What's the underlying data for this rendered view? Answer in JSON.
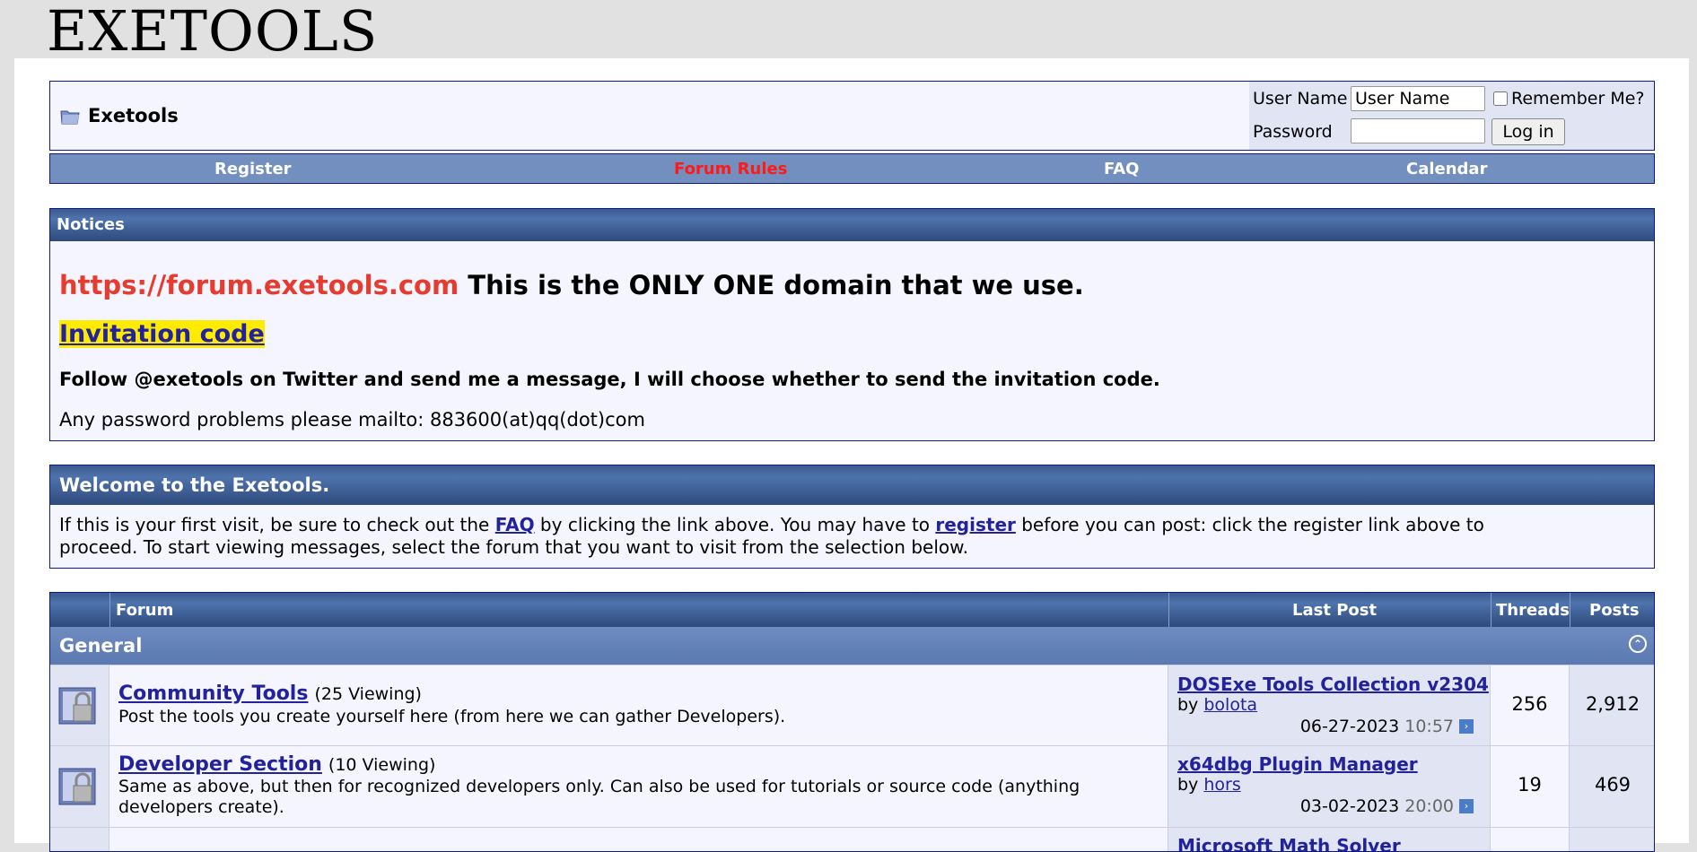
{
  "logo": "EXETOOLS",
  "header": {
    "title": "Exetools",
    "login": {
      "username_label": "User Name",
      "username_value": "User Name",
      "remember_label": "Remember Me?",
      "password_label": "Password",
      "login_button": "Log in"
    }
  },
  "navbar": [
    "Register",
    "Forum Rules",
    "FAQ",
    "Calendar"
  ],
  "notices": {
    "heading": "Notices",
    "domain_url": "https://forum.exetools.com",
    "domain_text": " This is the ONLY ONE domain that we use.",
    "invitation": "Invitation code",
    "follow": "Follow @exetools on Twitter and send me a message, I will choose whether to send the invitation code.",
    "mail": "Any password problems please mailto: 883600(at)qq(dot)com"
  },
  "welcome": {
    "heading": "Welcome to the Exetools.",
    "text1": "If this is your first visit, be sure to check out the ",
    "faq_link": "FAQ",
    "text2": " by clicking the link above. You may have to ",
    "register_link": "register",
    "text3": " before you can post: click the register link above to proceed. To start viewing messages, select the forum that you want to visit from the selection below."
  },
  "forum_table": {
    "columns": {
      "forum": "Forum",
      "last_post": "Last Post",
      "threads": "Threads",
      "posts": "Posts"
    },
    "category": "General",
    "rows": [
      {
        "title": "Community Tools",
        "viewing": "(25 Viewing)",
        "description": "Post the tools you create yourself here (from here we can gather Developers).",
        "last_post_title": "DOSExe Tools Collection v2304",
        "by": "by ",
        "author": "bolota",
        "date": "06-27-2023",
        "time": "10:57",
        "threads": "256",
        "posts": "2,912"
      },
      {
        "title": "Developer Section",
        "viewing": "(10 Viewing)",
        "description": "Same as above, but then for recognized developers only. Can also be used for tutorials or source code (anything developers create).",
        "last_post_title": "x64dbg Plugin Manager",
        "by": "by ",
        "author": "hors",
        "date": "03-02-2023",
        "time": "20:00",
        "threads": "19",
        "posts": "469"
      },
      {
        "last_post_title": "Microsoft Math Solver"
      }
    ]
  },
  "colors": {
    "nav_blue": "#738fbf",
    "header_dark": "#3b5a8e",
    "link": "#22229c",
    "red": "#e63b2e",
    "highlight": "#ffeb00"
  }
}
